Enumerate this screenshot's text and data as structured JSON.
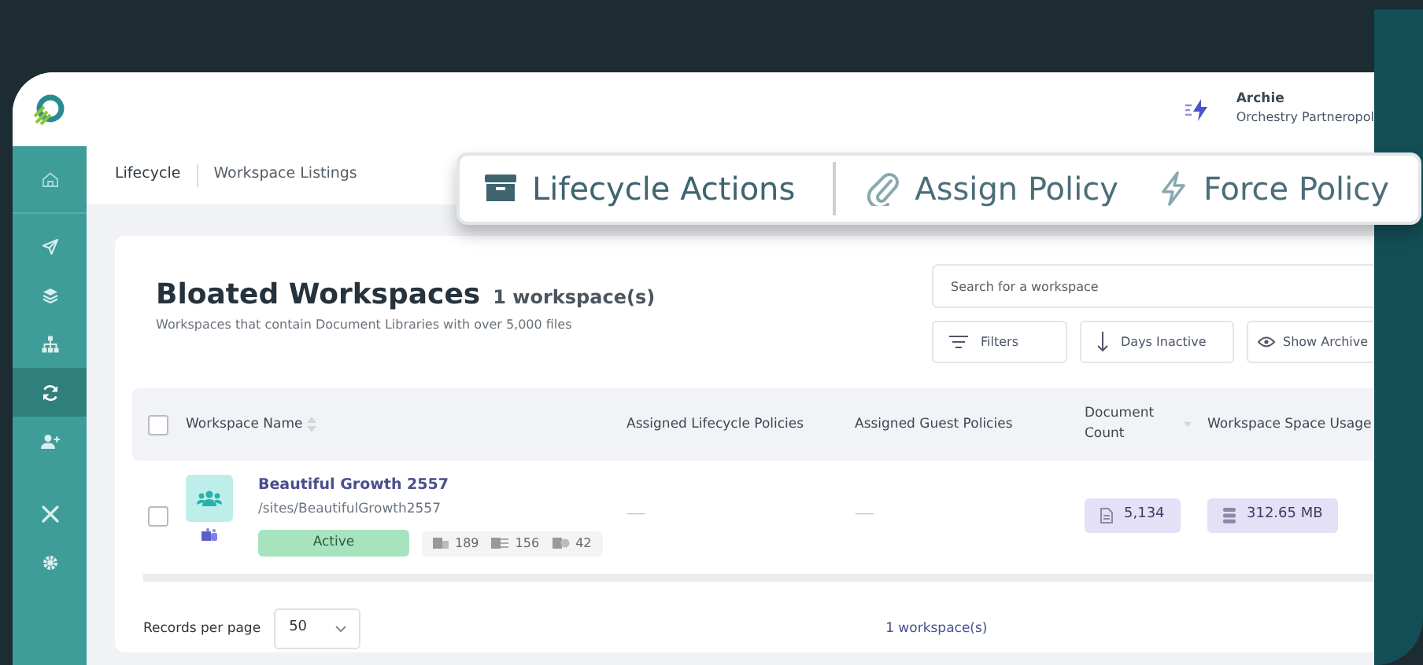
{
  "header": {
    "user_name": "Archie",
    "organization": "Orchestry Partneropol"
  },
  "sidebar": {
    "items": [
      {
        "selected": false
      },
      {
        "selected": false
      },
      {
        "selected": false
      },
      {
        "selected": false
      },
      {
        "selected": true
      },
      {
        "selected": false
      },
      {
        "selected": false
      },
      {
        "selected": false
      }
    ]
  },
  "breadcrumb": [
    "Lifecycle",
    "Workspace Listings"
  ],
  "action_bar": [
    "Lifecycle Actions",
    "Assign Policy",
    "Force Policy"
  ],
  "card": {
    "title": "Bloated Workspaces",
    "count": "1 workspace(s)",
    "subtitle": "Workspaces that contain Document Libraries with over 5,000 files",
    "search": {
      "placeholder": "Search for a workspace"
    },
    "buttons": [
      "Filters",
      "Days Inactive",
      "Show Archive"
    ]
  },
  "table": {
    "select_all_checked": false,
    "columns": [
      {
        "label": "Workspace Name",
        "sortable": true,
        "sorted": false
      },
      {
        "label": "Assigned Lifecycle Policies",
        "sortable": false,
        "sorted": false
      },
      {
        "label": "Assigned Guest Policies",
        "sortable": false,
        "sorted": false
      },
      {
        "label": "Document Count",
        "sorted": true
      },
      {
        "label": "Workspace Space Usage",
        "sortable": false,
        "sorted": false
      }
    ],
    "rows": [
      {
        "checked": false,
        "name": "Beautiful Growth 2557",
        "path": "/sites/BeautifulGrowth2557",
        "status": "Active",
        "stats": [
          "189",
          "156",
          "42"
        ],
        "lifecycle_policies": "------",
        "guest_policies": "------",
        "document_count": "5,134",
        "space_usage": "312.65 MB"
      }
    ]
  },
  "footer": {
    "records_label": "Records per page",
    "page_size": "50",
    "total": "1 workspace(s)"
  }
}
